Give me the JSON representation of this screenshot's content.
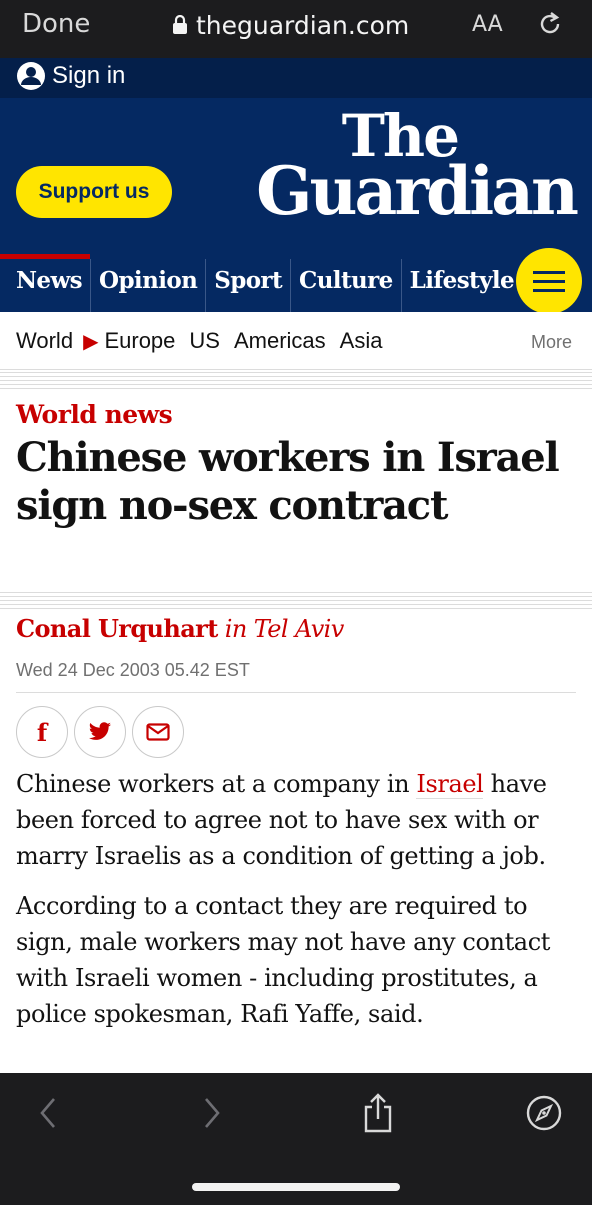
{
  "browser": {
    "done_label": "Done",
    "url": "theguardian.com",
    "text_size_label": "AA"
  },
  "header": {
    "signin_label": "Sign in",
    "support_label": "Support us",
    "logo_line1": "The",
    "logo_line2": "Guardian",
    "brand_color": "#052962",
    "accent_color": "#ffe500"
  },
  "pillars": [
    "News",
    "Opinion",
    "Sport",
    "Culture",
    "Lifestyle"
  ],
  "subnav": {
    "items": [
      "World",
      "Europe",
      "US",
      "Americas",
      "Asia"
    ],
    "more_label": "More"
  },
  "article": {
    "section": "World news",
    "headline": "Chinese workers in Israel sign no-sex contract",
    "author": "Conal Urquhart",
    "location": "in Tel Aviv",
    "date": "Wed 24 Dec 2003 05.42 EST",
    "para1_before": "Chinese workers at a company in ",
    "para1_link": "Israel",
    "para1_after": " have been forced to agree not to have sex with or marry Israelis as a condition of getting a job.",
    "para2": "According to a contact they are required to sign, male workers may not have any contact with Israeli women - including prostitutes, a police spokesman, Rafi Yaffe, said."
  },
  "share": {
    "facebook_label": "f"
  },
  "icons": {
    "lock": "lock-icon",
    "reload": "reload-icon",
    "person": "person-icon",
    "menu": "menu-icon",
    "triangle": "triangle-right-icon",
    "facebook": "facebook-icon",
    "twitter": "twitter-icon",
    "email": "email-icon",
    "back": "chevron-left-icon",
    "forward": "chevron-right-icon",
    "share": "share-icon",
    "compass": "compass-icon"
  },
  "colors": {
    "news_red": "#c70000",
    "toolbar": "#1c1c1e"
  }
}
